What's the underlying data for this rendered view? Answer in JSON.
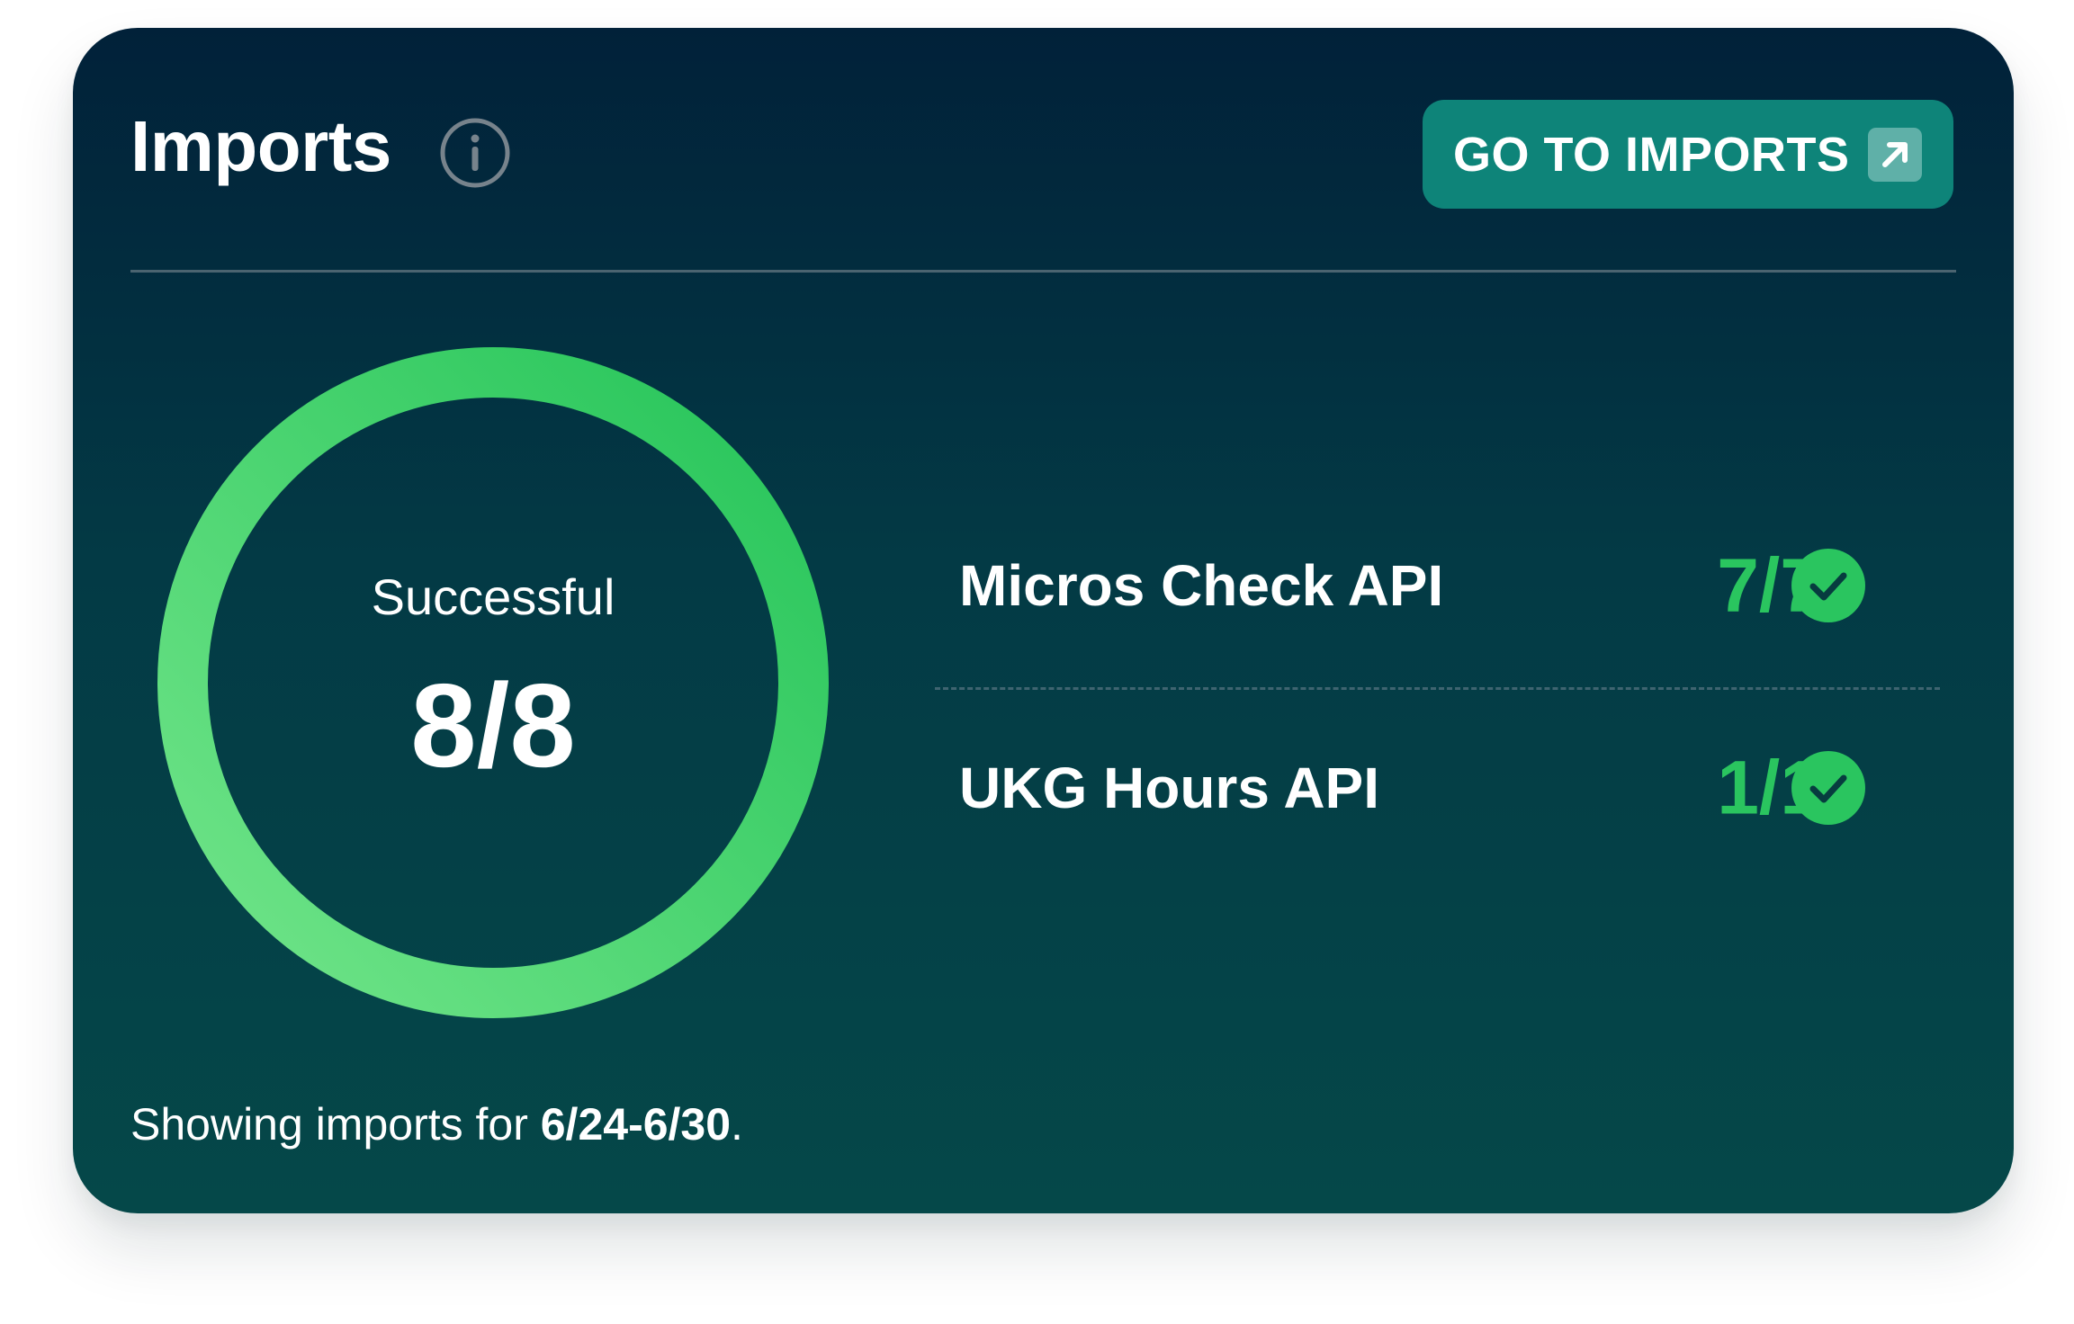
{
  "card": {
    "title": "Imports",
    "info_icon": "info-icon",
    "goto_button": {
      "label": "GO TO IMPORTS",
      "icon": "external-link-icon"
    }
  },
  "summary": {
    "label": "Successful",
    "value": "8/8",
    "successful": 8,
    "total": 8,
    "ring_color": "#2ac55f"
  },
  "sources": [
    {
      "name": "Micros Check API",
      "count": "7/7",
      "status_icon": "check-circle-icon"
    },
    {
      "name": "UKG Hours API",
      "count": "1/1",
      "status_icon": "check-circle-icon"
    }
  ],
  "footer": {
    "prefix": "Showing imports for ",
    "range": "6/24-6/30",
    "suffix": "."
  },
  "colors": {
    "accent": "#0e8479",
    "success": "#2ac55f",
    "background_top": "#012139",
    "background_bottom": "#054849"
  }
}
